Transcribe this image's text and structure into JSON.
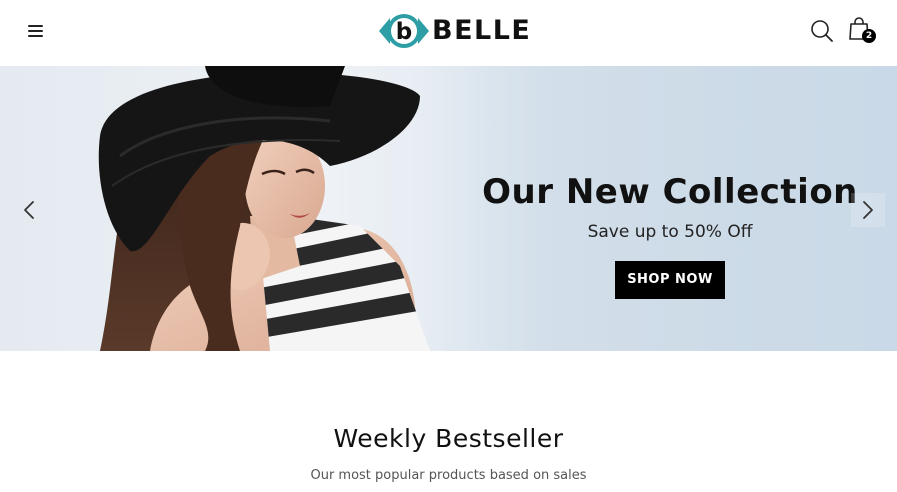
{
  "header": {
    "menu_icon": "hamburger-menu-icon",
    "logo": {
      "mark": "b",
      "text": "BELLE",
      "accent_color": "#2e9ea6"
    },
    "search_icon": "search-icon",
    "cart": {
      "icon": "shopping-bag-icon",
      "count": "2"
    }
  },
  "hero": {
    "title": "Our New Collection",
    "subtitle": "Save up to 50% Off",
    "cta_label": "SHOP NOW",
    "prev_icon": "chevron-left-icon",
    "next_icon": "chevron-right-icon",
    "image": "woman-in-black-hat-photo",
    "background_color": "#cddbe8"
  },
  "section": {
    "title": "Weekly Bestseller",
    "subtitle": "Our most popular products based on sales"
  }
}
